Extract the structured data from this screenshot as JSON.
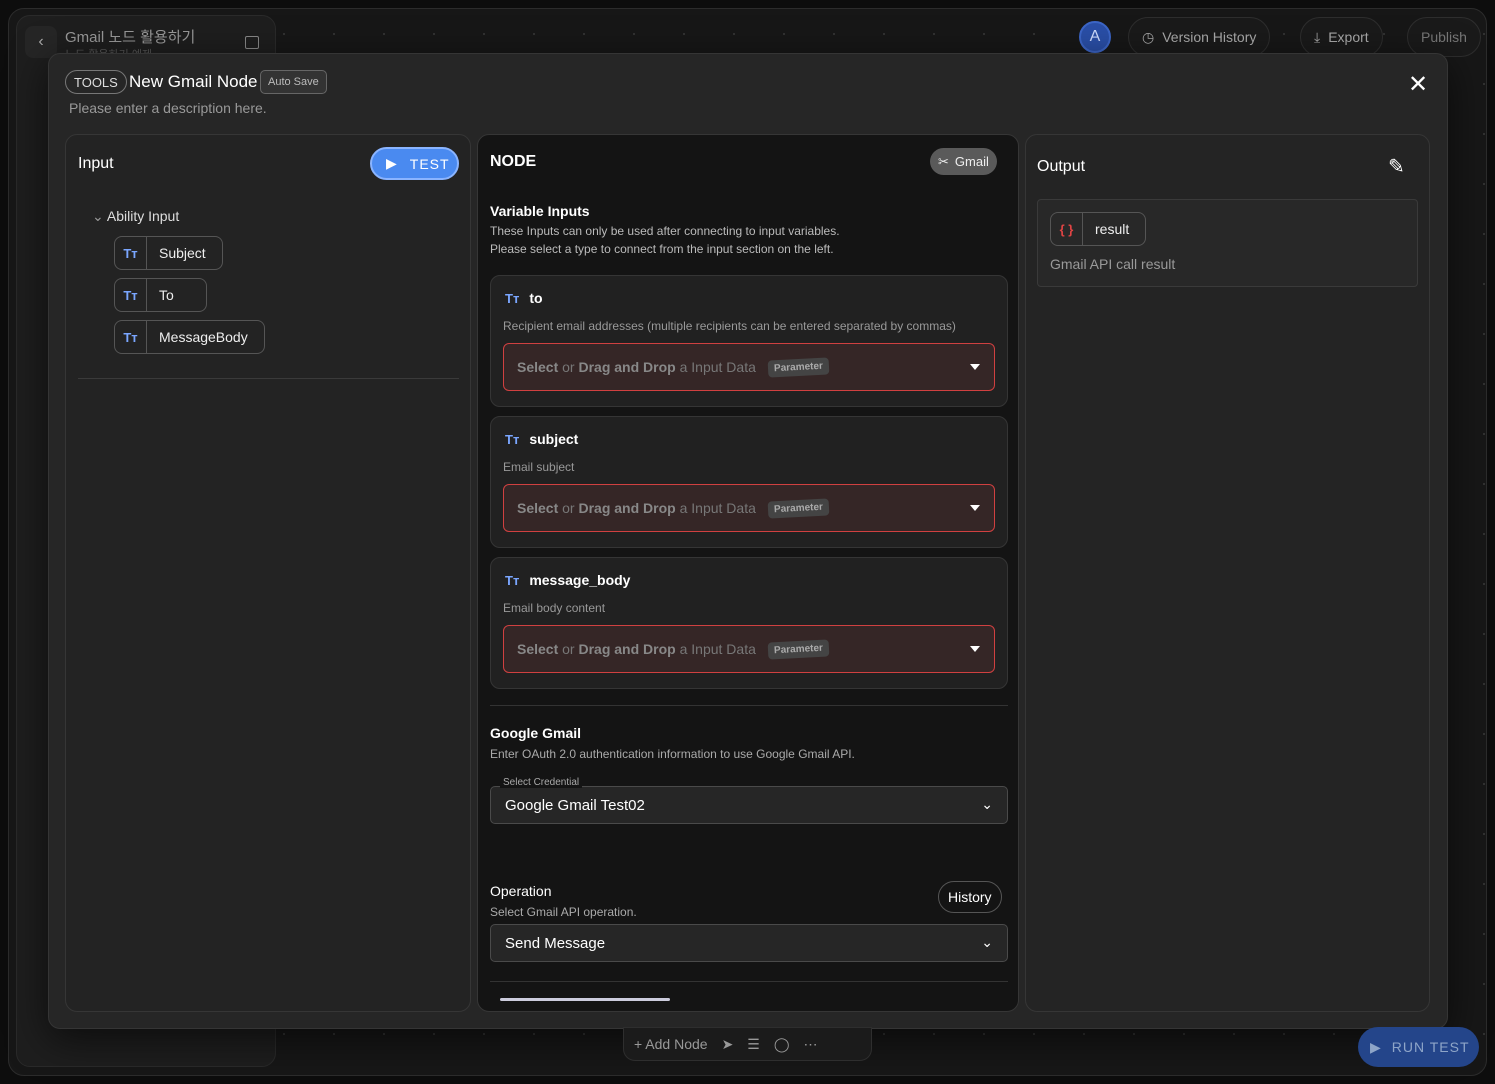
{
  "project": {
    "title": "Gmail 노드 활용하기",
    "subtitle": "노드 활용하기 예제"
  },
  "topbar": {
    "avatar": "A",
    "version_history": "Version History",
    "export": "Export",
    "publish": "Publish"
  },
  "modal": {
    "tag": "TOOLS",
    "title": "New Gmail Node",
    "autosave": "Auto Save",
    "description": "Please enter a description here.",
    "close": "✕"
  },
  "input_panel": {
    "title": "Input",
    "test": "TEST",
    "group": "Ability Input",
    "items": [
      {
        "icon": "Tт",
        "label": "Subject"
      },
      {
        "icon": "Tт",
        "label": "To"
      },
      {
        "icon": "Tт",
        "label": "MessageBody"
      }
    ]
  },
  "node_panel": {
    "title": "NODE",
    "badge": "Gmail",
    "variable_inputs": {
      "title": "Variable Inputs",
      "desc1": "These Inputs can only be used after connecting to input variables.",
      "desc2": "Please select a type to connect from the input section on the left."
    },
    "select": {
      "select": "Select",
      "or": " or ",
      "dnd": "Drag and Drop",
      "rest": " a Input Data",
      "param": "Parameter"
    },
    "fields": [
      {
        "name": "to",
        "desc": "Recipient email addresses (multiple recipients can be entered separated by commas)"
      },
      {
        "name": "subject",
        "desc": "Email subject"
      },
      {
        "name": "message_body",
        "desc": "Email body content"
      }
    ],
    "google": {
      "title": "Google Gmail",
      "desc": "Enter OAuth 2.0 authentication information to use Google Gmail API.",
      "cred_label": "Select Credential",
      "cred_value": "Google Gmail Test02"
    },
    "operation": {
      "title": "Operation",
      "desc": "Select Gmail API operation.",
      "history": "History",
      "value": "Send Message"
    }
  },
  "output_panel": {
    "title": "Output",
    "item": "result",
    "desc": "Gmail API call result"
  },
  "toolbar": {
    "add_node": "+ Add Node"
  },
  "run_test": "RUN TEST",
  "colors": {
    "accent": "#4a8af0",
    "error_border": "#d04040",
    "type_icon": "#7aa6ff"
  }
}
